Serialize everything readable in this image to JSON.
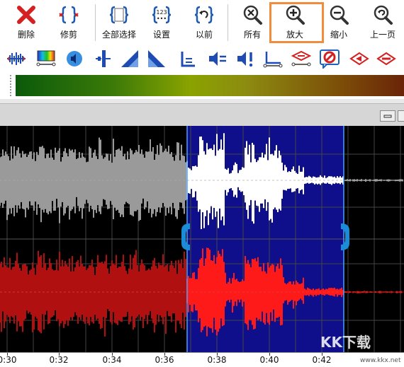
{
  "toolbar": {
    "buttons": [
      {
        "label": "删除",
        "icon": "delete-x-icon"
      },
      {
        "label": "修剪",
        "icon": "trim-icon"
      },
      {
        "label": "全部选择",
        "icon": "select-all-icon"
      },
      {
        "label": "设置",
        "icon": "settings-123-icon"
      },
      {
        "label": "以前",
        "icon": "previous-icon"
      },
      {
        "label": "所有",
        "icon": "zoom-all-icon"
      },
      {
        "label": "放大",
        "icon": "zoom-in-icon"
      },
      {
        "label": "缩小",
        "icon": "zoom-out-icon"
      },
      {
        "label": "上一页",
        "icon": "previous-page-icon"
      }
    ],
    "highlighted": "放大"
  },
  "toolbar2": {
    "icons": [
      "expand-waveform-icon",
      "spectrum-icon",
      "speaker-icon",
      "volume-fader-icon",
      "fade-in-icon",
      "fade-out-icon",
      "silence-icon",
      "normalize-icon",
      "amplify-icon",
      "envelope-icon",
      "marker-icon",
      "stop-icon",
      "reverse-icon",
      "effect-icon"
    ]
  },
  "colors": {
    "highlight": "#f08c3c",
    "selection": "#0f0f8c",
    "channel_left": "#e6e6e6",
    "channel_right": "#e01414"
  },
  "timeline": {
    "labels": [
      "0:30",
      "0:32",
      "0:34",
      "0:36",
      "0:38",
      "0:40",
      "0:42"
    ]
  },
  "selection": {
    "start": "0:37",
    "end": "0:42"
  },
  "watermark": {
    "text": "KK下载",
    "url": "www.kkx.net"
  }
}
